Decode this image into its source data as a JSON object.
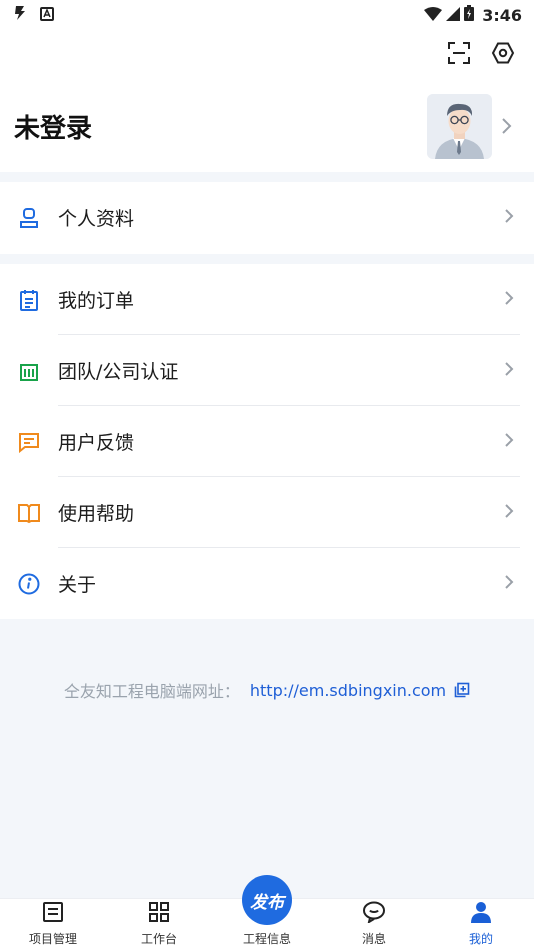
{
  "status_bar": {
    "time": "3:46"
  },
  "header": {
    "title": "未登录"
  },
  "profile": {
    "label": "个人资料"
  },
  "menu": [
    {
      "label": "我的订单",
      "icon": "order-icon"
    },
    {
      "label": "团队/公司认证",
      "icon": "company-icon"
    },
    {
      "label": "用户反馈",
      "icon": "feedback-icon"
    },
    {
      "label": "使用帮助",
      "icon": "help-book-icon"
    },
    {
      "label": "关于",
      "icon": "info-icon"
    }
  ],
  "site": {
    "label": "仝友知工程电脑端网址：",
    "url": "http://em.sdbingxin.com"
  },
  "nav": {
    "items": [
      {
        "label": "项目管理"
      },
      {
        "label": "工作台"
      },
      {
        "label": "工程信息"
      },
      {
        "label": "消息"
      },
      {
        "label": "我的"
      }
    ],
    "publish_label": "发布"
  },
  "colors": {
    "accent": "#1f6be0",
    "green": "#19a34a",
    "orange": "#f08a1c"
  }
}
